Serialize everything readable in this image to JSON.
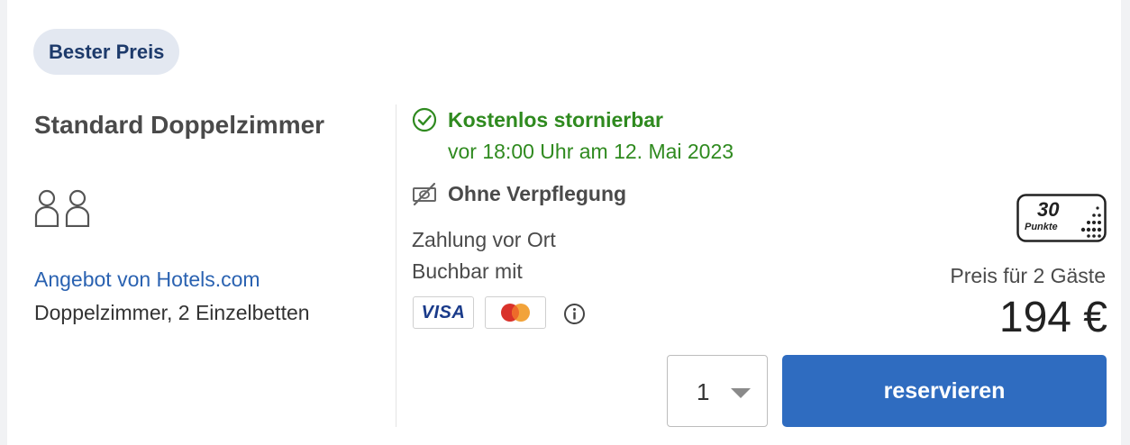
{
  "badge": {
    "label": "Bester Preis"
  },
  "room": {
    "title": "Standard Doppelzimmer",
    "occupancy_icon": "two-persons-icon",
    "offer_link": "Angebot von Hotels.com",
    "description": "Doppelzimmer, 2 Einzelbetten"
  },
  "cancellation": {
    "title": "Kostenlos stornierbar",
    "subtitle": "vor 18:00 Uhr am 12. Mai 2023",
    "icon": "check-circle-icon",
    "color": "#2f8a1f"
  },
  "meal": {
    "title": "Ohne Verpflegung",
    "icon": "no-meal-icon"
  },
  "payment": {
    "onsite": "Zahlung vor Ort",
    "bookable_with": "Buchbar mit",
    "cards": [
      "VISA",
      "mastercard"
    ],
    "visa_label": "VISA"
  },
  "points": {
    "value": "30",
    "label": "Punkte"
  },
  "pricing": {
    "guests_label": "Preis für 2 Gäste",
    "price": "194 €"
  },
  "quantity": {
    "value": "1"
  },
  "reserve_button": {
    "label": "reservieren",
    "color": "#2f6cc0"
  }
}
